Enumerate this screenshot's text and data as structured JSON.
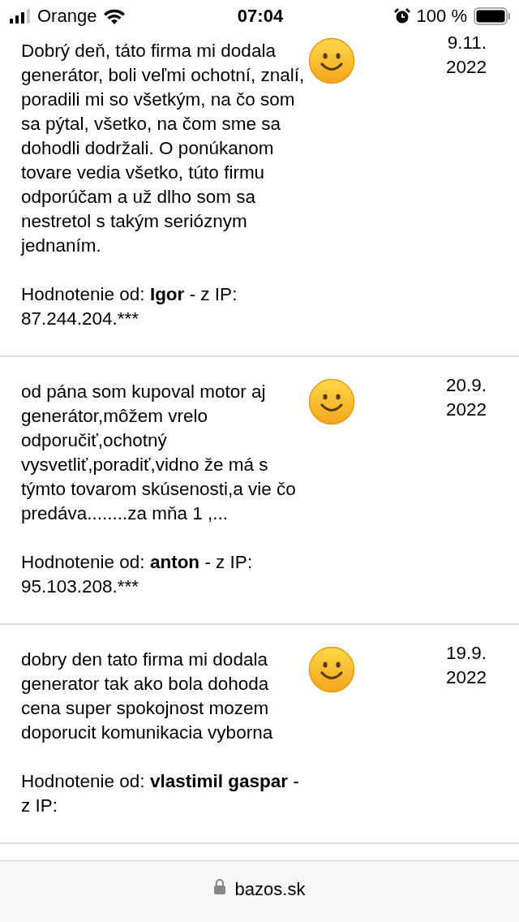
{
  "status_bar": {
    "carrier": "Orange",
    "time": "07:04",
    "battery": "100 %"
  },
  "reviews": [
    {
      "text": "Dobrý deň, táto firma mi dodala generátor, boli veľmi ochotní, znalí, poradili mi so všetkým, na čo som sa pýtal, všetko, na čom sme sa dohodli dodržali. O ponúkanom tovare vedia všetko, túto firmu odporúčam a už dlho som sa nestretol s takým serióznym jednaním.",
      "author": "Hodnotenie od: **Igor** - z IP: 87.244.204.***",
      "date": "9.11. 2022"
    },
    {
      "text": "od pána som kupoval motor aj generátor,môžem vrelo odporučiť,ochotný vysvetliť,poradiť,vidno že má s týmto tovarom skúsenosti,a vie čo predáva........za mňa 1 ,...",
      "author": "Hodnotenie od: **anton** - z IP: 95.103.208.***",
      "date": "20.9. 2022"
    },
    {
      "text": "dobry den tato firma mi dodala generator tak ako bola dohoda cena super spokojnost mozem doporucit komunikacia vyborna",
      "author": "Hodnotenie od: **vlastimil gaspar** - z IP:",
      "date": "19.9. 2022"
    }
  ],
  "address_bar": {
    "url": "bazos.sk"
  }
}
